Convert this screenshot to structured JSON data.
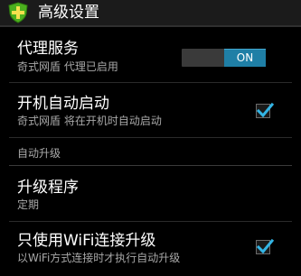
{
  "header": {
    "title": "高级设置",
    "icon": "shield-cross-icon",
    "icon_color": "#4caf1e"
  },
  "prefs": {
    "proxy": {
      "title": "代理服务",
      "summary": "奇式网盾 代理已启用",
      "switch_label": "ON",
      "switch_on": true
    },
    "autostart": {
      "title": "开机自动启动",
      "summary": "奇式网盾 将在开机时自动启动",
      "checked": true
    },
    "category_upgrade": "自动升级",
    "upgrade_program": {
      "title": "升级程序",
      "summary": "定期"
    },
    "wifi_only": {
      "title": "只使用WiFi连接升级",
      "summary": "以WiFi方式连接时才执行自动升级",
      "checked": true
    }
  },
  "colors": {
    "accent": "#1f7fa6",
    "check": "#33b5e5"
  }
}
